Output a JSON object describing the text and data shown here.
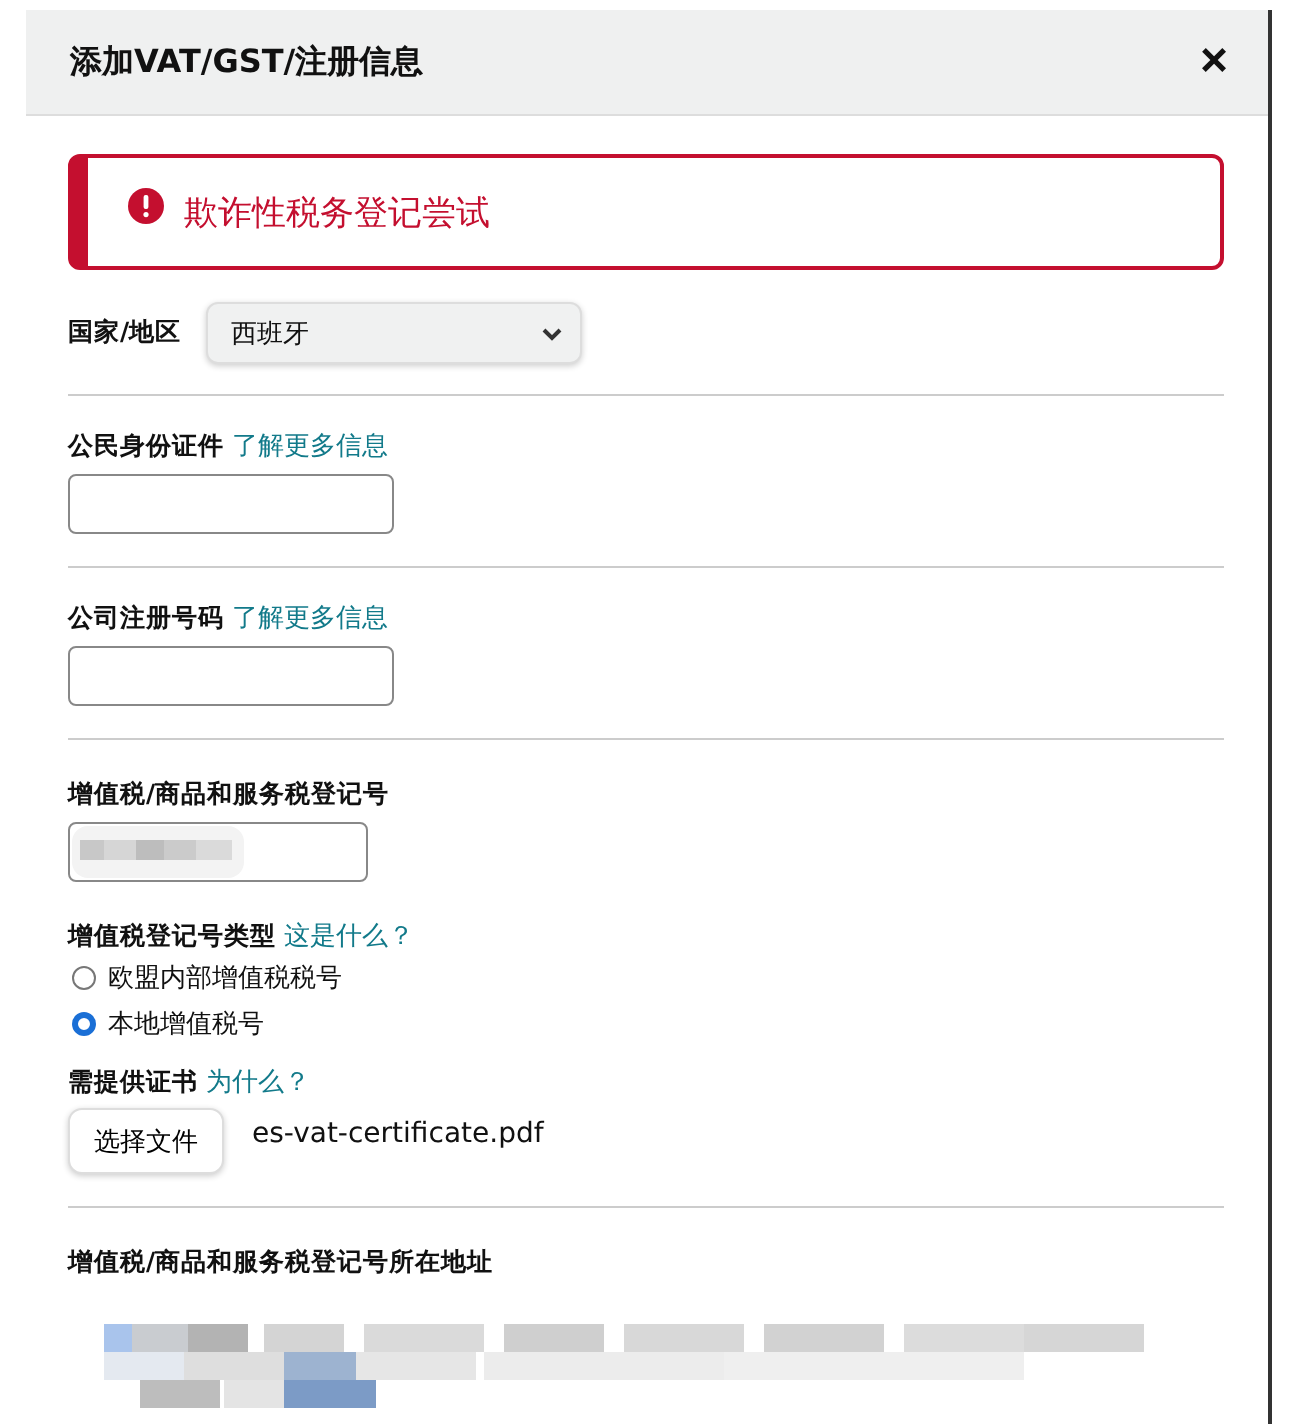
{
  "dialog": {
    "title": "添加VAT/GST/注册信息",
    "close": "×"
  },
  "alert": {
    "message": "欺诈性税务登记尝试"
  },
  "country": {
    "label": "国家/地区",
    "value": "西班牙"
  },
  "citizen_id": {
    "label": "公民身份证件",
    "link": "了解更多信息"
  },
  "company_number": {
    "label": "公司注册号码",
    "link": "了解更多信息"
  },
  "vat_number": {
    "label": "增值税/商品和服务税登记号",
    "redacted": true
  },
  "vat_type": {
    "label": "增值税登记号类型",
    "link": "这是什么？",
    "options": [
      {
        "label": "欧盟内部增值税税号",
        "selected": false
      },
      {
        "label": "本地增值税号",
        "selected": true
      }
    ]
  },
  "certificate": {
    "label": "需提供证书",
    "link": "为什么？",
    "button": "选择文件",
    "file": "es-vat-certificate.pdf"
  },
  "address": {
    "label": "增值税/商品和服务税登记号所在地址",
    "redacted": true
  }
}
